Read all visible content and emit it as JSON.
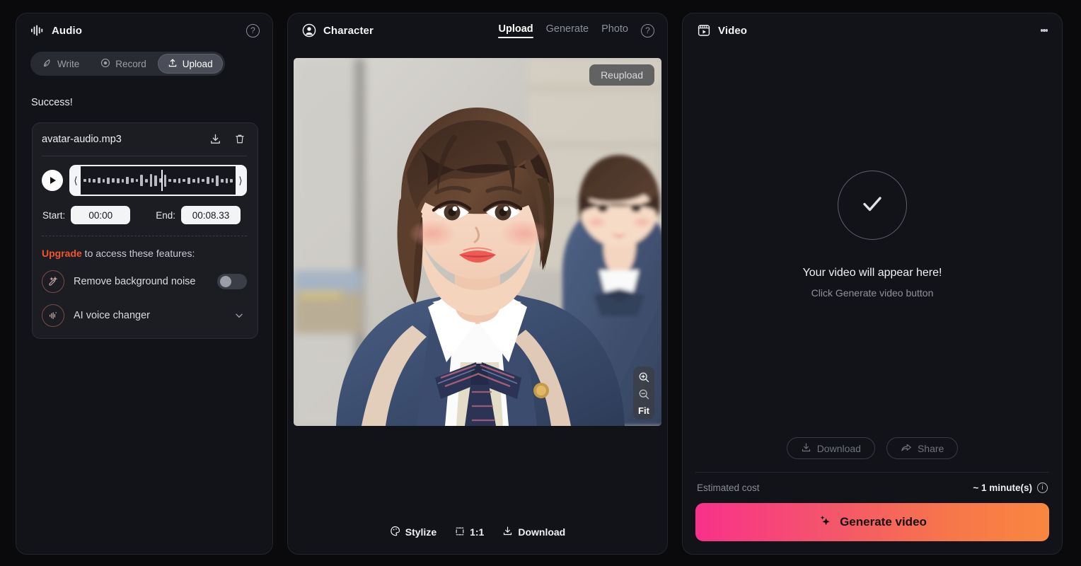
{
  "audio": {
    "title": "Audio",
    "help_icon": "help-circle-icon",
    "icon": "waveform-icon",
    "tabs": [
      {
        "label": "Write",
        "icon": "feather-pen-icon",
        "active": false
      },
      {
        "label": "Record",
        "icon": "record-dot-icon",
        "active": false
      },
      {
        "label": "Upload",
        "icon": "upload-arrow-icon",
        "active": true
      }
    ],
    "status": "Success!",
    "file": {
      "name": "avatar-audio.mp3",
      "download_icon": "download-icon",
      "delete_icon": "trash-icon",
      "play_icon": "play-icon"
    },
    "trim": {
      "start_label": "Start:",
      "start_value": "00:00",
      "end_label": "End:",
      "end_value": "00:08.33"
    },
    "upgrade": {
      "link": "Upgrade",
      "text": " to access these features:",
      "features": [
        {
          "label": "Remove background noise",
          "icon": "noise-remove-icon",
          "control": "toggle",
          "on": false
        },
        {
          "label": "AI voice changer",
          "icon": "voice-wave-icon",
          "control": "chevron",
          "on": false
        }
      ]
    }
  },
  "character": {
    "title": "Character",
    "icon": "user-avatar-icon",
    "help_icon": "help-circle-icon",
    "tabs": [
      {
        "label": "Upload",
        "active": true
      },
      {
        "label": "Generate",
        "active": false
      },
      {
        "label": "Photo",
        "active": false
      }
    ],
    "image": {
      "alt": "schoolgirl-portrait",
      "reupload_label": "Reupload",
      "zoom_in_icon": "zoom-in-icon",
      "zoom_out_icon": "zoom-out-icon",
      "fit_label": "Fit"
    },
    "footer": [
      {
        "label": "Stylize",
        "icon": "palette-icon"
      },
      {
        "label": "1:1",
        "icon": "crop-icon"
      },
      {
        "label": "Download",
        "icon": "download-icon"
      }
    ]
  },
  "video": {
    "title": "Video",
    "icon": "video-clip-icon",
    "menu_icon": "kebab-menu-icon",
    "placeholder": {
      "check_icon": "check-icon",
      "headline": "Your video will appear here!",
      "subtext": "Click Generate video button"
    },
    "actions": [
      {
        "label": "Download",
        "icon": "download-icon"
      },
      {
        "label": "Share",
        "icon": "share-arrow-icon"
      }
    ],
    "cost": {
      "label": "Estimated cost",
      "value": "~ 1 minute(s)",
      "info_icon": "info-circle-icon"
    },
    "generate": {
      "label": "Generate video",
      "icon": "sparkle-icon",
      "gradient_from": "#f9318a",
      "gradient_to": "#f9873f"
    }
  },
  "colors": {
    "page_bg": "#0a0a0c",
    "panel_bg": "#121318",
    "accent_orange": "#f2552c",
    "text_primary": "#f1f2f5",
    "text_muted": "#8b8f99"
  }
}
